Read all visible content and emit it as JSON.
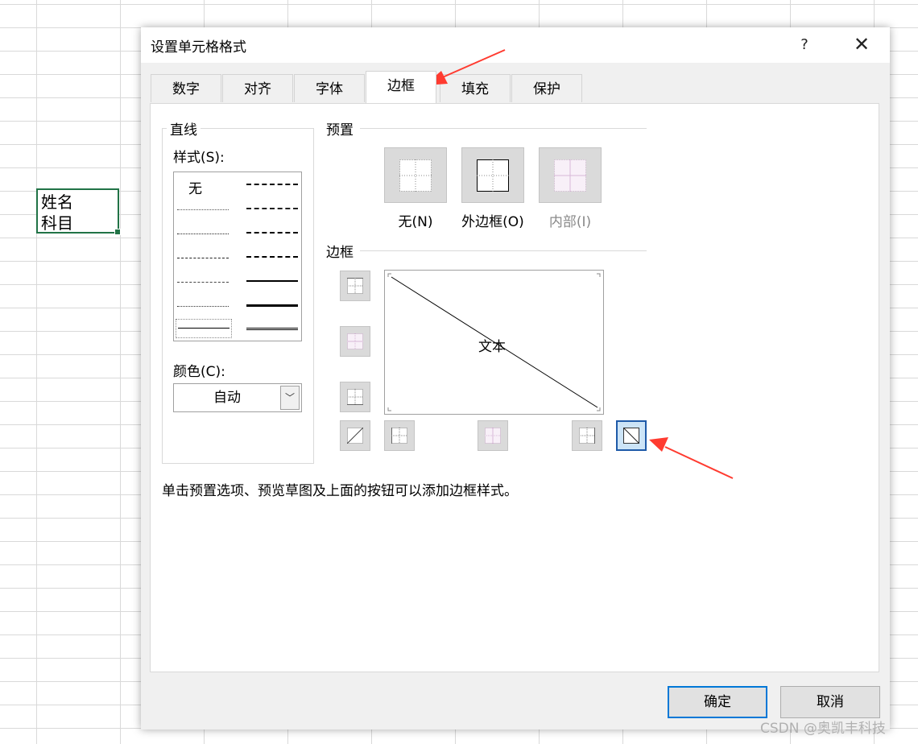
{
  "sheet": {
    "cell_lines": [
      "姓名",
      "科目"
    ]
  },
  "dialog": {
    "title": "设置单元格格式",
    "help_label": "?",
    "close_label": "✕",
    "tabs": [
      {
        "label": "数字",
        "active": false
      },
      {
        "label": "对齐",
        "active": false
      },
      {
        "label": "字体",
        "active": false
      },
      {
        "label": "边框",
        "active": true
      },
      {
        "label": "填充",
        "active": false
      },
      {
        "label": "保护",
        "active": false
      }
    ],
    "line": {
      "group_label": "直线",
      "style_label": "样式(S):",
      "style_none": "无",
      "color_label": "颜色(C):",
      "color_value": "自动"
    },
    "presets": {
      "section_label": "预置",
      "items": [
        {
          "label": "无(N)",
          "icon": "preset-none-icon",
          "enabled": true
        },
        {
          "label": "外边框(O)",
          "icon": "preset-outline-icon",
          "enabled": true
        },
        {
          "label": "内部(I)",
          "icon": "preset-inside-icon",
          "enabled": false
        }
      ]
    },
    "border": {
      "section_label": "边框",
      "preview_text": "文本"
    },
    "hint": "单击预置选项、预览草图及上面的按钮可以添加边框样式。",
    "ok_label": "确定",
    "cancel_label": "取消"
  },
  "watermark": "CSDN @奥凯丰科技",
  "colors": {
    "accent": "#0078d7",
    "selected_border": "#1e5aa8",
    "annotation_arrow": "#ff3b30",
    "cell_border": "#217346"
  }
}
